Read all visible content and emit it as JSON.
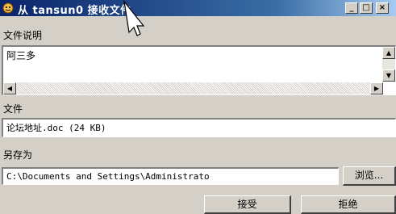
{
  "window": {
    "title": "从 tansun0 接收文件",
    "minimize_icon": "minimize-icon",
    "maximize_icon": "maximize-icon",
    "close_icon": "close-icon"
  },
  "description": {
    "label": "文件说明",
    "text": "阿三多"
  },
  "file": {
    "label": "文件",
    "value": "论坛地址.doc (24 KB)"
  },
  "saveas": {
    "label": "另存为",
    "path": "C:\\Documents and Settings\\Administrato",
    "browse_label": "浏览..."
  },
  "actions": {
    "accept_label": "接受",
    "reject_label": "拒绝"
  },
  "colors": {
    "titlebar_start": "#0a246a",
    "titlebar_end": "#a6caf0",
    "window_bg": "#d4d0c8"
  }
}
